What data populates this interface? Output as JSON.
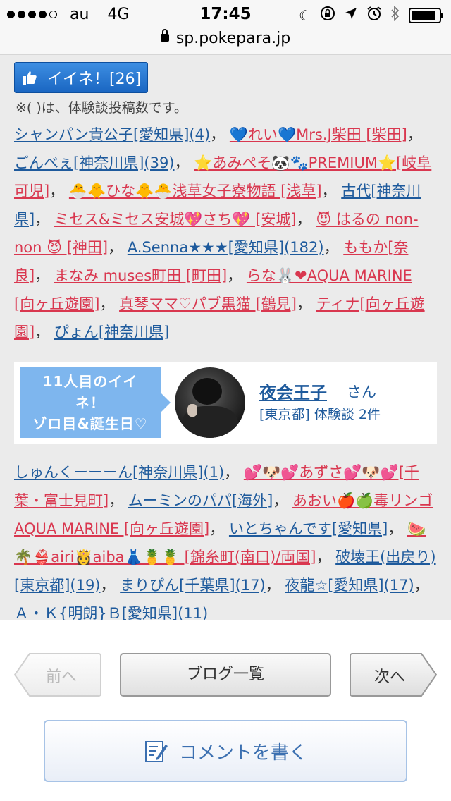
{
  "status": {
    "carrier": "au",
    "network": "4G",
    "time": "17:45",
    "icons": [
      "moon-icon",
      "orientation-lock-icon",
      "location-arrow-icon",
      "alarm-icon",
      "bluetooth-icon",
      "battery-icon"
    ],
    "battery_level": 0.9
  },
  "url": {
    "host": "sp.pokepara.jp"
  },
  "like": {
    "label": "イイネ！[26]",
    "icon": "thumbs-up-icon",
    "note": "※( )は、体験談投稿数です。"
  },
  "names1": [
    {
      "text": "シャンパン貴公子[愛知県](4)",
      "color": "blue"
    },
    {
      "text": "💙れい💙Mrs.J柴田 [柴田]",
      "color": "pink"
    },
    {
      "text": "ごんべぇ[神奈川県](39)",
      "color": "blue"
    },
    {
      "text": "⭐あみぺそ🐼🐾PREMIUM⭐[岐阜 可児]",
      "color": "pink"
    },
    {
      "text": "🐣🐥ひな🐥🐣浅草女子寮物語 [浅草]",
      "color": "pink"
    },
    {
      "text": "古代[神奈川県]",
      "color": "blue"
    },
    {
      "text": "ミセス&ミセス安城💖さち💖 [安城]",
      "color": "pink"
    },
    {
      "text": "😈 はるの non-non 😈 [神田]",
      "color": "pink"
    },
    {
      "text": "A.Senna★★★[愛知県](182)",
      "color": "blue"
    },
    {
      "text": "ももか[奈良]",
      "color": "pink"
    },
    {
      "text": "まなみ muses町田 [町田]",
      "color": "pink"
    },
    {
      "text": "らな🐰❤AQUA MARINE [向ヶ丘遊園]",
      "color": "pink"
    },
    {
      "text": "真琴ママ♡パブ黒猫 [鶴見]",
      "color": "pink"
    },
    {
      "text": "ティナ[向ヶ丘遊園]",
      "color": "pink"
    },
    {
      "text": "ぴょん[神奈川県]",
      "color": "blue"
    }
  ],
  "featured": {
    "badge_lines": [
      "11人目のイイ",
      "ネ！",
      "ゾロ目&誕生日♡"
    ],
    "name": "夜会王子",
    "suffix": "さん",
    "meta": "[東京都] 体験談 2件"
  },
  "names2": [
    {
      "text": "しゅんくーーーん[神奈川県](1)",
      "color": "blue"
    },
    {
      "text": "💕🐶💕あずさ💕🐶💕[千葉・富士見町]",
      "color": "pink"
    },
    {
      "text": "ムーミンのパパ[海外]",
      "color": "blue"
    },
    {
      "text": "あおい🍎🍏毒リンゴ AQUA MARINE [向ヶ丘遊園]",
      "color": "pink"
    },
    {
      "text": "いとちゃんです[愛知県]",
      "color": "blue"
    },
    {
      "text": "🍉🌴👙airi👸aiba👗🍍🍍 [錦糸町(南口)/両国]",
      "color": "pink"
    },
    {
      "text": "破壊王(出戻り)[東京都](19)",
      "color": "blue"
    },
    {
      "text": "まりぴん[千葉県](17)",
      "color": "blue"
    },
    {
      "text": "夜龍☆[愛知県](17)",
      "color": "blue"
    },
    {
      "text": "Ａ・Ｋ{明朗}Ｂ[愛知県](11)",
      "color": "blue"
    }
  ],
  "nav": {
    "prev": "前へ",
    "list": "ブログ一覧",
    "next": "次へ",
    "comment": "コメントを書く"
  }
}
